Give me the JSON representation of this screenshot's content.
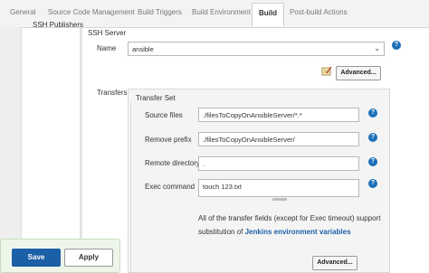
{
  "tabs": [
    {
      "label": "General"
    },
    {
      "label": "Source Code Management"
    },
    {
      "label": "Build Triggers"
    },
    {
      "label": "Build Environment"
    },
    {
      "label": "Build"
    },
    {
      "label": "Post-build Actions"
    }
  ],
  "active_tab": "Build",
  "section": {
    "label": "SSH Publishers"
  },
  "ssh_server": {
    "heading": "SSH Server",
    "name_label": "Name",
    "name_value": "ansible",
    "advanced_label": "Advanced..."
  },
  "transfers": {
    "label": "Transfers",
    "set_title": "Transfer Set",
    "fields": {
      "source_files": {
        "label": "Source files",
        "value": "./filesToCopyOnAnsibleServer/*.*"
      },
      "remove_prefix": {
        "label": "Remove prefix",
        "value": "./filesToCopyOnAnsibleServer/"
      },
      "remote_directory": {
        "label": "Remote directory",
        "value": "."
      },
      "exec_command": {
        "label": "Exec command",
        "value": "touch 123.txt"
      }
    },
    "description_text": "All of the transfer fields (except for Exec timeout) support substitution of",
    "description_link": "Jenkins environment variables",
    "advanced_label": "Advanced..."
  },
  "buttons": {
    "save": "Save",
    "apply": "Apply"
  },
  "icons": {
    "help": "?",
    "chevron": "⌄"
  },
  "colors": {
    "accent": "#1b5fa6",
    "help": "#1b6fb8"
  }
}
